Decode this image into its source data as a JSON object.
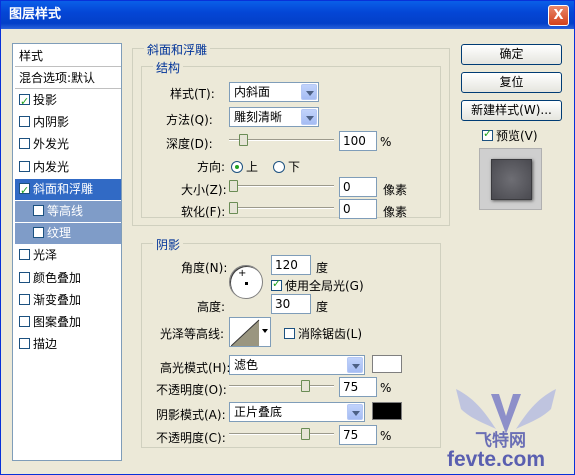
{
  "window": {
    "title": "图层样式",
    "close": "X"
  },
  "left_list": {
    "header1": "样式",
    "header2": "混合选项:默认",
    "items": [
      {
        "label": "投影",
        "checked": true
      },
      {
        "label": "内阴影",
        "checked": false
      },
      {
        "label": "外发光",
        "checked": false
      },
      {
        "label": "内发光",
        "checked": false
      },
      {
        "label": "斜面和浮雕",
        "checked": true
      },
      {
        "label": "等高线",
        "checked": false
      },
      {
        "label": "纹理",
        "checked": false
      },
      {
        "label": "光泽",
        "checked": false
      },
      {
        "label": "颜色叠加",
        "checked": false
      },
      {
        "label": "渐变叠加",
        "checked": false
      },
      {
        "label": "图案叠加",
        "checked": false
      },
      {
        "label": "描边",
        "checked": false
      }
    ]
  },
  "bevel": {
    "group_title": "斜面和浮雕",
    "structure_title": "结构",
    "style_label": "样式(T):",
    "style_value": "内斜面",
    "technique_label": "方法(Q):",
    "technique_value": "雕刻清晰",
    "depth_label": "深度(D):",
    "depth_value": "100",
    "depth_unit": "%",
    "direction_label": "方向:",
    "dir_up": "上",
    "dir_down": "下",
    "size_label": "大小(Z):",
    "size_value": "0",
    "size_unit": "像素",
    "soften_label": "软化(F):",
    "soften_value": "0",
    "soften_unit": "像素"
  },
  "shading": {
    "title": "阴影",
    "angle_label": "角度(N):",
    "angle_value": "120",
    "angle_unit": "度",
    "global_light": "使用全局光(G)",
    "altitude_label": "高度:",
    "altitude_value": "30",
    "altitude_unit": "度",
    "gloss_label": "光泽等高线:",
    "antialias": "消除锯齿(L)",
    "highlight_label": "高光模式(H):",
    "highlight_value": "滤色",
    "highlight_color": "#ffffff",
    "opacity1_label": "不透明度(O):",
    "opacity1_value": "75",
    "shadow_label": "阴影模式(A):",
    "shadow_value": "正片叠底",
    "shadow_color": "#000000",
    "opacity2_label": "不透明度(C):",
    "opacity2_value": "75",
    "pct": "%"
  },
  "buttons": {
    "ok": "确定",
    "cancel": "复位",
    "new_style": "新建样式(W)...",
    "preview": "预览(V)"
  },
  "watermark": {
    "text1": "飞特网",
    "text2": "fevte.com"
  },
  "sliders": {
    "depth": 0.1,
    "size": 0.0,
    "soften": 0.0,
    "opacity1": 0.75,
    "opacity2": 0.75
  }
}
